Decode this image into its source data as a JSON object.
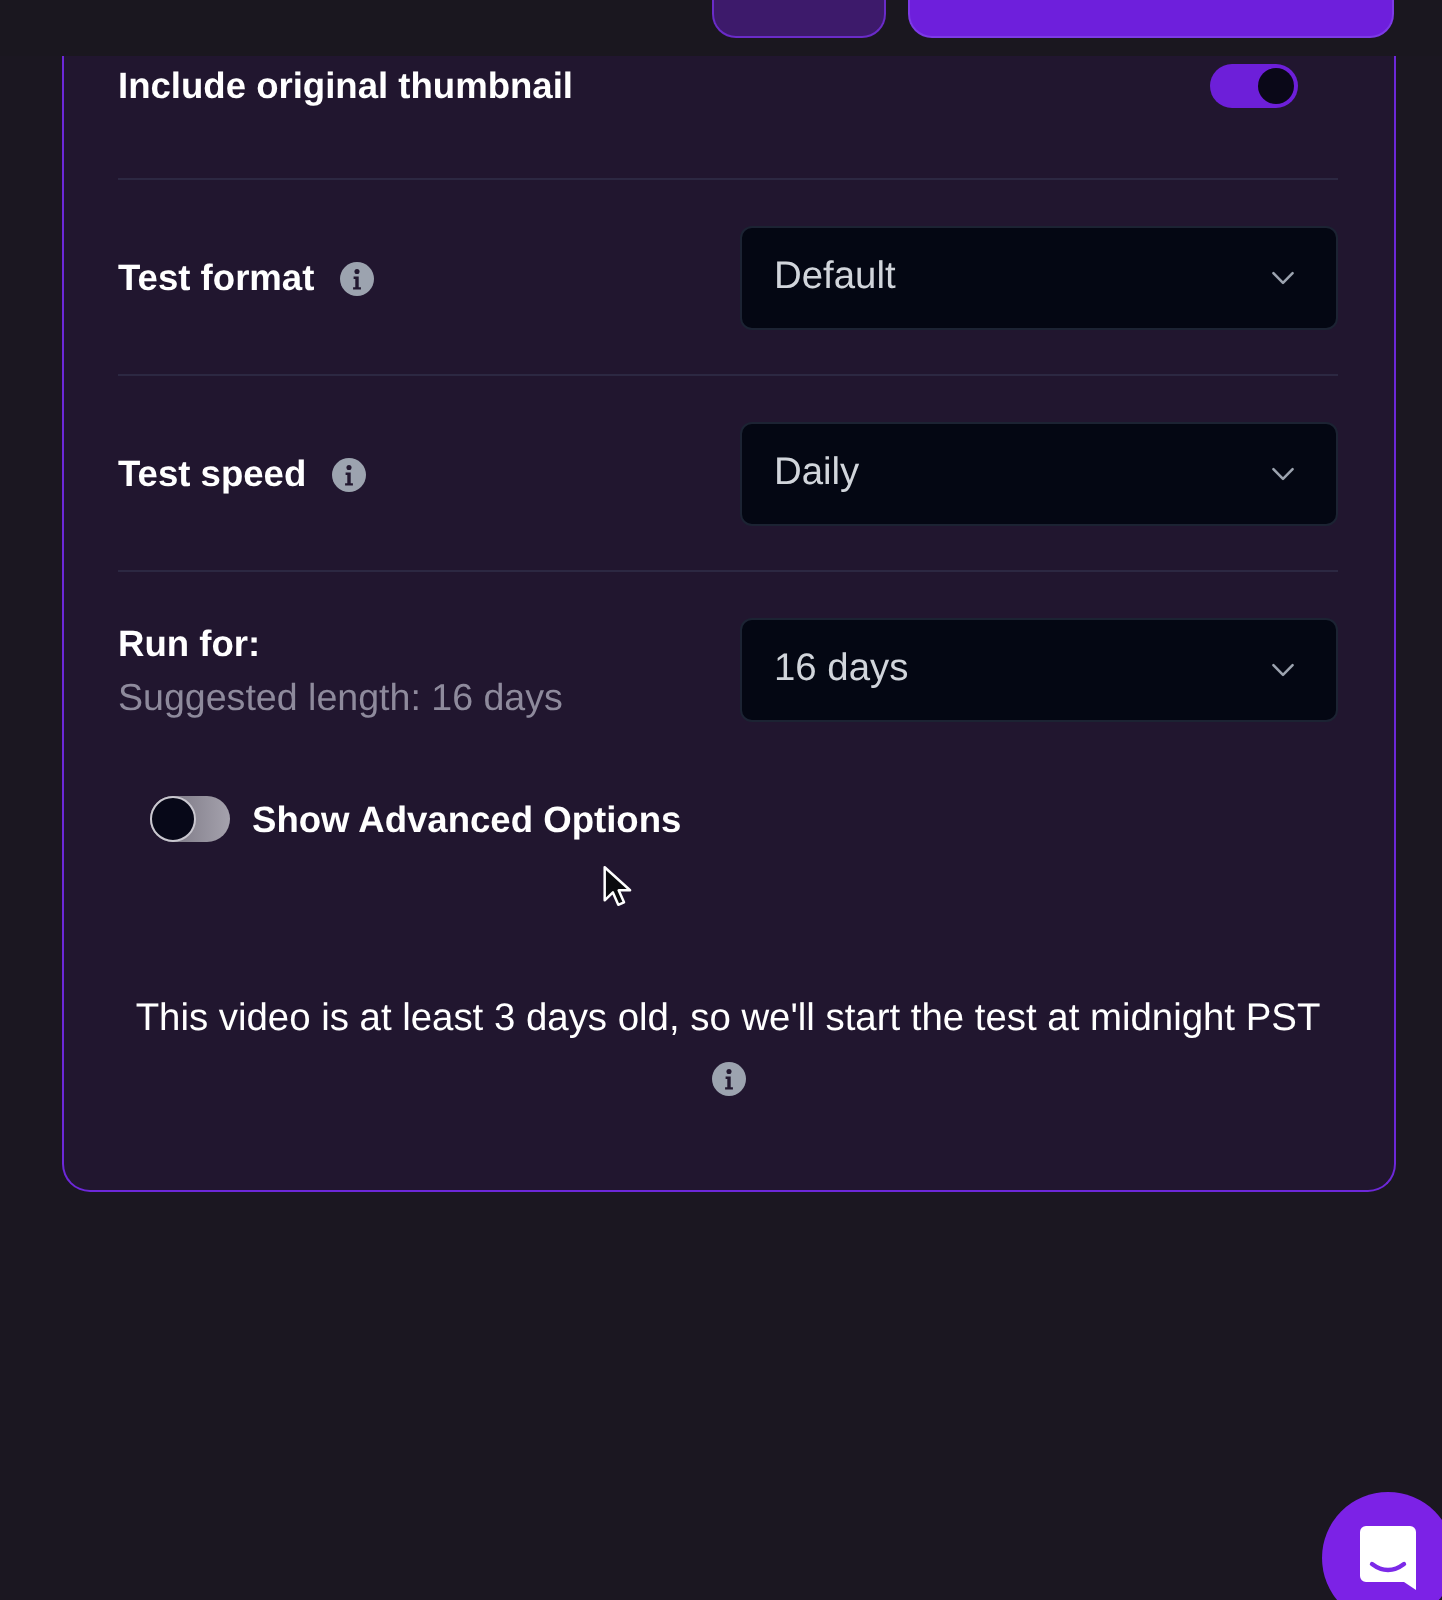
{
  "header": {
    "buttons": [
      {
        "kind": "secondary"
      },
      {
        "kind": "primary"
      }
    ]
  },
  "settings": [
    {
      "kind": "toggle",
      "label": "Include original thumbnail",
      "on": true
    },
    {
      "kind": "select",
      "label": "Test format",
      "info": true,
      "value": "Default"
    },
    {
      "kind": "select",
      "label": "Test speed",
      "info": true,
      "value": "Daily"
    },
    {
      "kind": "select",
      "label": "Run for:",
      "info": false,
      "hint": "Suggested length: 16 days",
      "value": "16 days"
    }
  ],
  "advanced_toggle": {
    "label": "Show Advanced Options",
    "on": false
  },
  "notice": {
    "text": "This video is at least 3 days old, so we'll start the test at midnight PST"
  }
}
